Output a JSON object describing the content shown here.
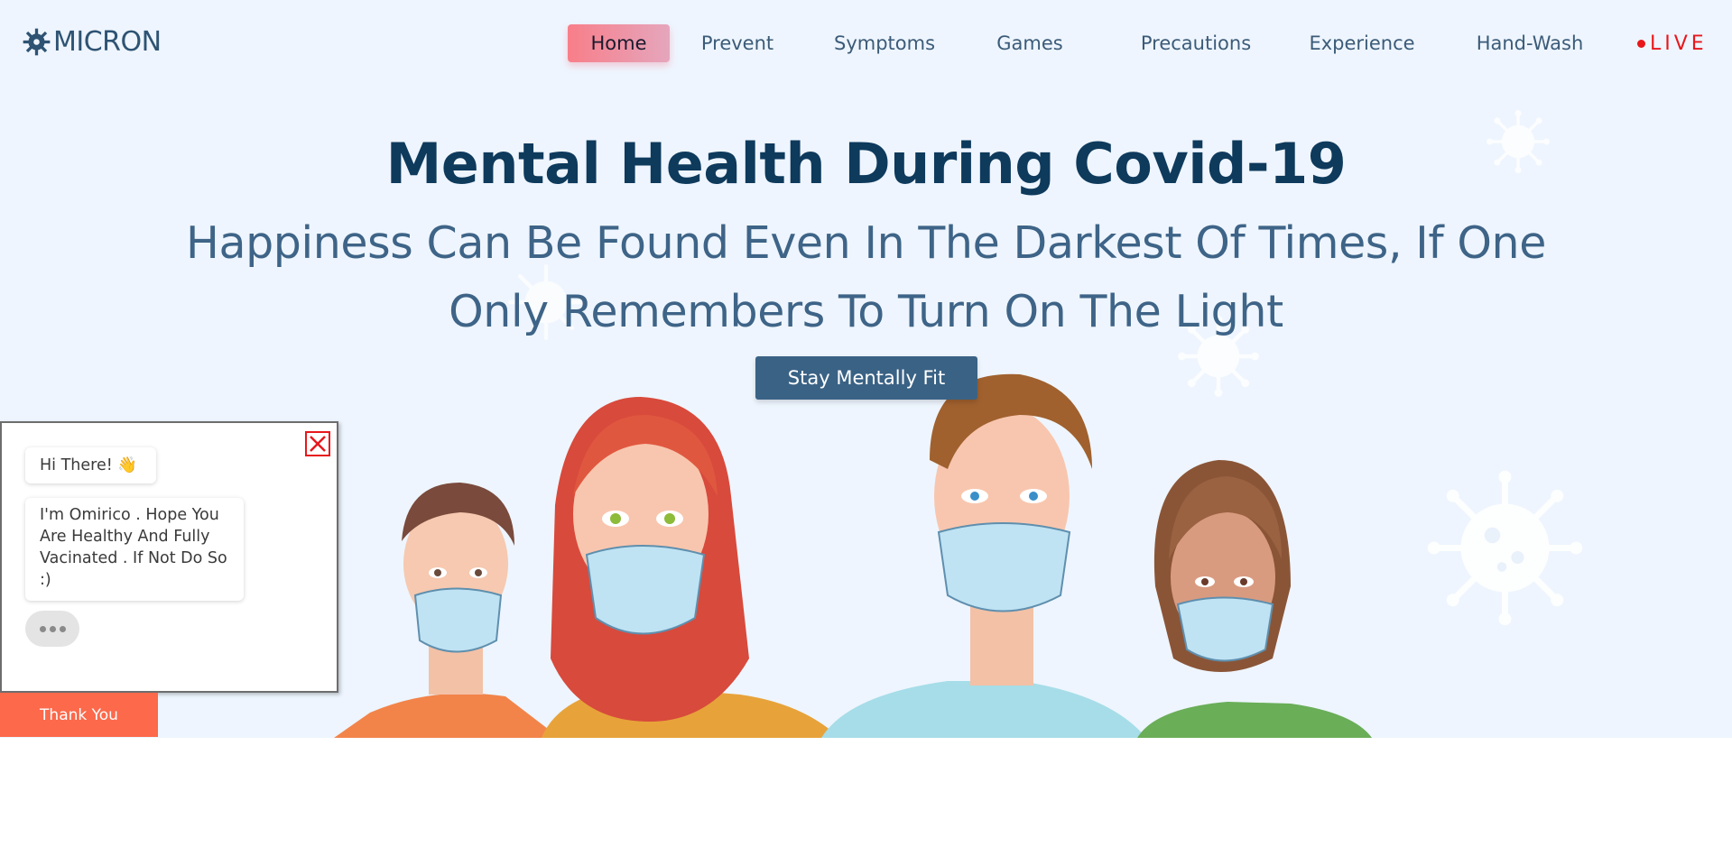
{
  "brand": {
    "logo_icon": "virus-gear-icon",
    "name": "MICRON"
  },
  "nav": {
    "items": [
      {
        "label": "Home",
        "active": true
      },
      {
        "label": "Prevent",
        "active": false
      },
      {
        "label": "Symptoms",
        "active": false
      },
      {
        "label": "Games",
        "active": false
      },
      {
        "label": "Precautions",
        "active": false
      },
      {
        "label": "Experience",
        "active": false
      },
      {
        "label": "Hand-Wash",
        "active": false
      }
    ],
    "live_label": "LIVE"
  },
  "hero": {
    "title": "Mental Health During Covid-19",
    "subtitle_line1": "Happiness Can Be Found Even In The Darkest Of Times, If One",
    "subtitle_line2": "Only Remembers To Turn On The Light",
    "cta_label": "Stay Mentally Fit"
  },
  "chat": {
    "close_icon": "close-icon",
    "greeting": "Hi There! 👋",
    "message": "I'm Omirico . Hope You Are Healthy And Fully Vacinated . If Not Do So :)",
    "typing_indicator": "typing-dots-icon",
    "thanks_button": "Thank You"
  },
  "colors": {
    "hero_bg": "#eef5fe",
    "title": "#0e3a5c",
    "subtitle": "#3e6487",
    "cta_bg": "#3a6285",
    "live_red": "#e8171b",
    "thanks_bg": "#fc694b",
    "active_nav_from": "#f87e89",
    "active_nav_to": "#e5a6bd"
  }
}
